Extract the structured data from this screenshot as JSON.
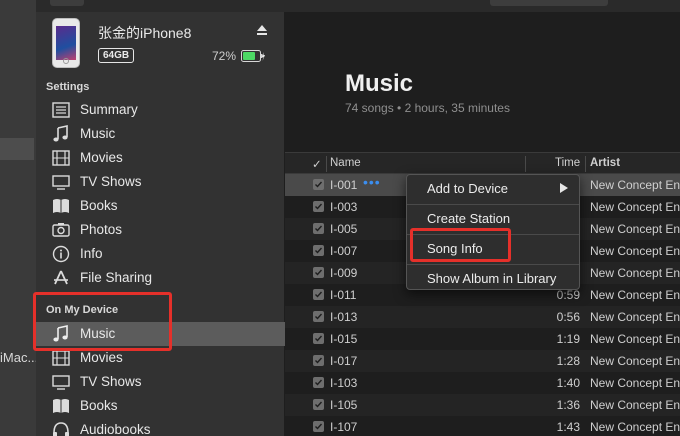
{
  "desktop": {
    "partial_label": "iMac..."
  },
  "device": {
    "name": "张金的iPhone8",
    "capacity": "64GB",
    "battery_percent": "72%"
  },
  "sidebar": {
    "settings_title": "Settings",
    "settings_items": [
      {
        "label": "Summary",
        "icon": "summary-icon"
      },
      {
        "label": "Music",
        "icon": "music-note-icon"
      },
      {
        "label": "Movies",
        "icon": "film-icon"
      },
      {
        "label": "TV Shows",
        "icon": "tv-icon"
      },
      {
        "label": "Books",
        "icon": "book-icon"
      },
      {
        "label": "Photos",
        "icon": "camera-icon"
      },
      {
        "label": "Info",
        "icon": "info-icon"
      },
      {
        "label": "File Sharing",
        "icon": "app-store-icon"
      }
    ],
    "device_title": "On My Device",
    "device_items": [
      {
        "label": "Music",
        "icon": "music-note-icon"
      },
      {
        "label": "Movies",
        "icon": "film-icon"
      },
      {
        "label": "TV Shows",
        "icon": "tv-icon"
      },
      {
        "label": "Books",
        "icon": "book-icon"
      },
      {
        "label": "Audiobooks",
        "icon": "headphones-icon"
      }
    ]
  },
  "main": {
    "title": "Music",
    "subtitle": "74 songs • 2 hours, 35 minutes"
  },
  "table": {
    "headers": {
      "check": "✓",
      "name": "Name",
      "time": "Time",
      "artist": "Artist"
    },
    "rows": [
      {
        "name": "I-001",
        "time": "",
        "artist": "New Concept En"
      },
      {
        "name": "I-003",
        "time": "",
        "artist": "New Concept En"
      },
      {
        "name": "I-005",
        "time": "",
        "artist": "New Concept En"
      },
      {
        "name": "I-007",
        "time": "",
        "artist": "New Concept En"
      },
      {
        "name": "I-009",
        "time": "",
        "artist": "New Concept En"
      },
      {
        "name": "I-011",
        "time": "0:59",
        "artist": "New Concept En"
      },
      {
        "name": "I-013",
        "time": "0:56",
        "artist": "New Concept En"
      },
      {
        "name": "I-015",
        "time": "1:19",
        "artist": "New Concept En"
      },
      {
        "name": "I-017",
        "time": "1:28",
        "artist": "New Concept En"
      },
      {
        "name": "I-103",
        "time": "1:40",
        "artist": "New Concept En"
      },
      {
        "name": "I-105",
        "time": "1:36",
        "artist": "New Concept En"
      },
      {
        "name": "I-107",
        "time": "1:43",
        "artist": "New Concept En"
      }
    ],
    "row_more_glyph": "•••"
  },
  "context_menu": {
    "items": [
      "Add to Device",
      "Create Station",
      "Song Info",
      "Show Album in Library"
    ]
  },
  "colors": {
    "highlight_red": "#e5302a",
    "accent_blue": "#3b8ef0",
    "battery_green": "#4cd964"
  }
}
